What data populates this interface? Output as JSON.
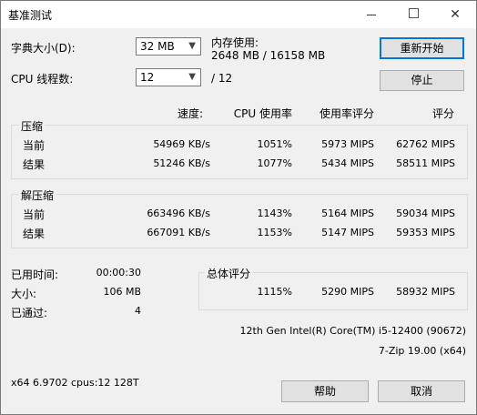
{
  "window": {
    "title": "基准测试"
  },
  "controls": {
    "dict_label": "字典大小(D):",
    "dict_value": "32 MB",
    "threads_label": "CPU 线程数:",
    "threads_value": "12",
    "threads_total": "/ 12",
    "memory_label": "内存使用:",
    "memory_value": "2648 MB / 16158 MB",
    "restart_button": "重新开始",
    "stop_button": "停止"
  },
  "columns": {
    "speed": "速度:",
    "cpu": "CPU 使用率",
    "usage_rating": "使用率评分",
    "rating": "评分"
  },
  "compress": {
    "title": "压缩",
    "rows": [
      {
        "label": "当前",
        "speed": "54969 KB/s",
        "cpu": "1051%",
        "usage": "5973 MIPS",
        "rating": "62762 MIPS"
      },
      {
        "label": "结果",
        "speed": "51246 KB/s",
        "cpu": "1077%",
        "usage": "5434 MIPS",
        "rating": "58511 MIPS"
      }
    ]
  },
  "decompress": {
    "title": "解压缩",
    "rows": [
      {
        "label": "当前",
        "speed": "663496 KB/s",
        "cpu": "1143%",
        "usage": "5164 MIPS",
        "rating": "59034 MIPS"
      },
      {
        "label": "结果",
        "speed": "667091 KB/s",
        "cpu": "1153%",
        "usage": "5147 MIPS",
        "rating": "59353 MIPS"
      }
    ]
  },
  "stats": {
    "elapsed_label": "已用时间:",
    "elapsed_value": "00:00:30",
    "size_label": "大小:",
    "size_value": "106 MB",
    "passed_label": "已通过:",
    "passed_value": "4"
  },
  "total": {
    "title": "总体评分",
    "cpu": "1115%",
    "usage": "5290 MIPS",
    "rating": "58932 MIPS"
  },
  "system": {
    "cpu_name": "12th Gen Intel(R) Core(TM) i5-12400 (90672)",
    "version": "7-Zip 19.00 (x64)",
    "platform": "x64 6.9702 cpus:12 128T"
  },
  "footer": {
    "help_button": "帮助",
    "cancel_button": "取消"
  },
  "icons": {
    "minimize": "minimize-icon",
    "maximize": "maximize-icon",
    "close": "close-icon"
  }
}
